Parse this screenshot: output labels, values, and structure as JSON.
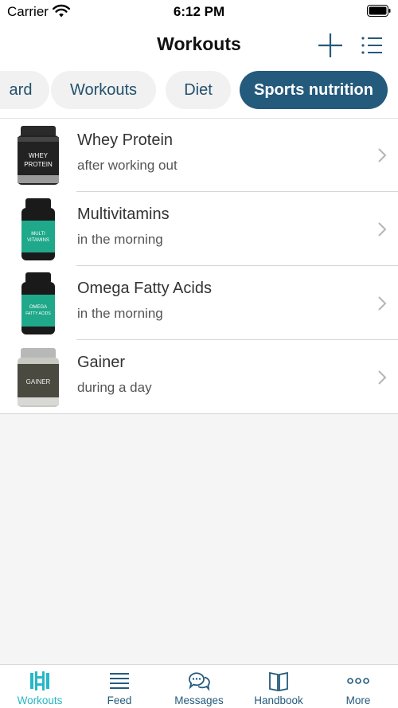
{
  "status_bar": {
    "carrier": "Carrier",
    "time": "6:12 PM"
  },
  "nav": {
    "title": "Workouts",
    "add_icon": "plus-icon",
    "list_icon": "list-icon"
  },
  "segments": {
    "items": [
      {
        "label": "ard",
        "active": false
      },
      {
        "label": "Workouts",
        "active": false
      },
      {
        "label": "Diet",
        "active": false
      },
      {
        "label": "Sports nutrition",
        "active": true
      }
    ]
  },
  "supplements": [
    {
      "title": "Whey Protein",
      "subtitle": "after working out",
      "jar_label": "WHEY PROTEIN",
      "jar_color": "#1a1a1a",
      "lid_color": "#2a2a2a"
    },
    {
      "title": "Multivitamins",
      "subtitle": "in the morning",
      "jar_label": "MULTI VITAMINS",
      "jar_color": "#1fa88a",
      "lid_color": "#1a1a1a"
    },
    {
      "title": "Omega Fatty Acids",
      "subtitle": "in the morning",
      "jar_label": "OMEGA FATTY ACIDS",
      "jar_color": "#1fa88a",
      "lid_color": "#1a1a1a"
    },
    {
      "title": "Gainer",
      "subtitle": "during a day",
      "jar_label": "GAINER",
      "jar_color": "#4a4a40",
      "lid_color": "#b8b8b8"
    }
  ],
  "tab_bar": {
    "items": [
      {
        "label": "Workouts",
        "icon": "dumbbell-icon",
        "active": true
      },
      {
        "label": "Feed",
        "icon": "feed-icon",
        "active": false
      },
      {
        "label": "Messages",
        "icon": "messages-icon",
        "active": false
      },
      {
        "label": "Handbook",
        "icon": "book-icon",
        "active": false
      },
      {
        "label": "More",
        "icon": "more-icon",
        "active": false
      }
    ]
  },
  "colors": {
    "accent": "#245a7c",
    "active_tab": "#27b7c7",
    "background": "#f4f5f4"
  }
}
